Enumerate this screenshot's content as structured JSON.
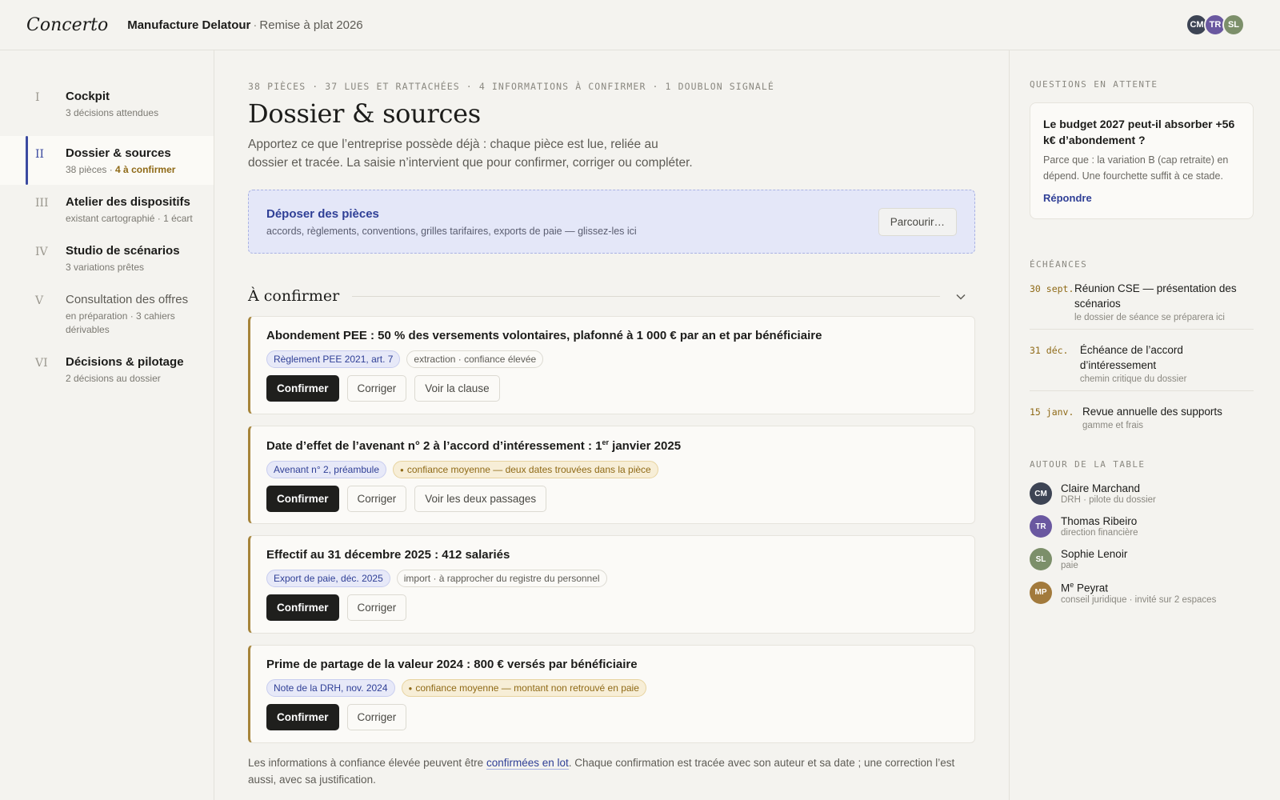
{
  "app": {
    "logo": "Concerto",
    "org": "Manufacture Delatour",
    "separator": "·",
    "project": "Remise à plat 2026"
  },
  "header_avatars": [
    {
      "initials": "CM",
      "color": "#3d4454"
    },
    {
      "initials": "TR",
      "color": "#6a58a0"
    },
    {
      "initials": "SL",
      "color": "#7c8f6a"
    }
  ],
  "sidebar": {
    "items": [
      {
        "roman": "I",
        "label": "Cockpit",
        "sub": "3 décisions attendues"
      },
      {
        "roman": "II",
        "label": "Dossier & sources",
        "sub": "38 pièces · ",
        "sub_warn": "4 à confirmer"
      },
      {
        "roman": "III",
        "label": "Atelier des dispositifs",
        "sub": "existant cartographié · 1 écart"
      },
      {
        "roman": "IV",
        "label": "Studio de scénarios",
        "sub": "3 variations prêtes"
      },
      {
        "roman": "V",
        "label": "Consultation des offres",
        "sub": "en préparation · 3 cahiers dérivables"
      },
      {
        "roman": "VI",
        "label": "Décisions & pilotage",
        "sub": "2 décisions au dossier"
      }
    ]
  },
  "main": {
    "stats": "38 PIÈCES · 37 LUES ET RATTACHÉES · 4 INFORMATIONS À CONFIRMER · 1 DOUBLON SIGNALÉ",
    "title": "Dossier & sources",
    "lead": "Apportez ce que l’entreprise possède déjà : chaque pièce est lue, reliée au dossier et tracée. La saisie n’intervient que pour confirmer, corriger ou compléter.",
    "dropzone": {
      "title": "Déposer des pièces",
      "sub": "accords, règlements, conventions, grilles tarifaires, exports de paie — glissez-les ici",
      "button": "Parcourir…"
    },
    "section_title": "À confirmer",
    "buttons": {
      "confirm": "Confirmer",
      "correct": "Corriger"
    },
    "cards": [
      {
        "title": "Abondement PEE : 50 % des versements volontaires, plafonné à 1 000 € par an et par bénéficiaire",
        "source": "Règlement PEE 2021, art. 7",
        "confidence": "extraction · confiance élevée",
        "extra": "Voir la clause"
      },
      {
        "title": "Date d’effet de l’avenant n° 2 à l’accord d’intéressement : 1er janvier 2025",
        "source": "Avenant n° 2, préambule",
        "confidence": "confiance moyenne — deux dates trouvées dans la pièce",
        "extra": "Voir les deux passages"
      },
      {
        "title": "Effectif au 31 décembre 2025 : 412 salariés",
        "source": "Export de paie, déc. 2025",
        "confidence": "import · à rapprocher du registre du personnel"
      },
      {
        "title": "Prime de partage de la valeur 2024 : 800 € versés par bénéficiaire",
        "source": "Note de la DRH, nov. 2024",
        "confidence": "confiance moyenne — montant non retrouvé en paie"
      }
    ],
    "footnote": {
      "before": "Les informations à confiance élevée peuvent être ",
      "link": "confirmées en lot",
      "after": ". Chaque confirmation est tracée avec son auteur et sa date ; une correction l’est aussi, avec sa justification."
    }
  },
  "right": {
    "questions_head": "QUESTIONS EN ATTENTE",
    "question": {
      "title": "Le budget 2027 peut-il absorber +56 k€ d’abondement ?",
      "body": "Parce que : la variation B (cap retraite) en dépend. Une fourchette suffit à ce stade.",
      "link": "Répondre"
    },
    "deadlines_head": "ÉCHÉANCES",
    "deadlines": [
      {
        "date": "30 sept.",
        "title": "Réunion CSE — présentation des scénarios",
        "sub": "le dossier de séance se préparera ici"
      },
      {
        "date": "31 déc.",
        "title": "Échéance de l’accord d’intéressement",
        "sub": "chemin critique du dossier"
      },
      {
        "date": "15 janv.",
        "title": "Revue annuelle des supports",
        "sub": "gamme et frais"
      }
    ],
    "people_head": "AUTOUR DE LA TABLE",
    "people": [
      {
        "initials": "CM",
        "name": "Claire Marchand",
        "role": "DRH · pilote du dossier",
        "color": "#3d4454"
      },
      {
        "initials": "TR",
        "name": "Thomas Ribeiro",
        "role": "direction financière",
        "color": "#6a58a0"
      },
      {
        "initials": "SL",
        "name": "Sophie Lenoir",
        "role": "paie",
        "color": "#7c8f6a"
      },
      {
        "initials": "MP",
        "name": "Me Peyrat",
        "role": "conseil juridique · invité sur 2 espaces",
        "color": "#a27a3c"
      }
    ]
  }
}
